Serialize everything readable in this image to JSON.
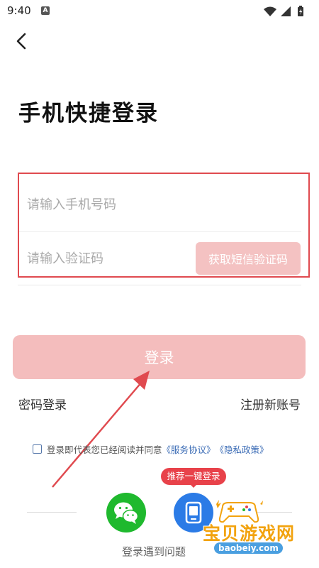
{
  "status_bar": {
    "time": "9:40",
    "badge": "A"
  },
  "header": {
    "title": "手机快捷登录"
  },
  "form": {
    "phone_placeholder": "请输入手机号码",
    "code_placeholder": "请输入验证码",
    "sms_button_label": "获取短信验证码"
  },
  "actions": {
    "login_label": "登录",
    "password_login_label": "密码登录",
    "register_label": "注册新账号"
  },
  "agreement": {
    "text": "登录即代表您已经阅读并同意",
    "service_link": "《服务协议》",
    "privacy_link": "《隐私政策》",
    "checked": false
  },
  "other_login": {
    "recommend_tag": "推荐一键登录",
    "icons": [
      "wechat-icon",
      "phone-icon"
    ]
  },
  "help": {
    "label": "登录遇到问题"
  },
  "watermark": {
    "title": "宝贝游戏网",
    "url": "baobeiy.com"
  },
  "colors": {
    "primary_disabled": "#f4bdbd",
    "annotation": "#e04a4f",
    "link": "#3a6bb5",
    "wechat": "#1fb92e",
    "onekey": "#2b7be6",
    "tag": "#e8424a"
  }
}
